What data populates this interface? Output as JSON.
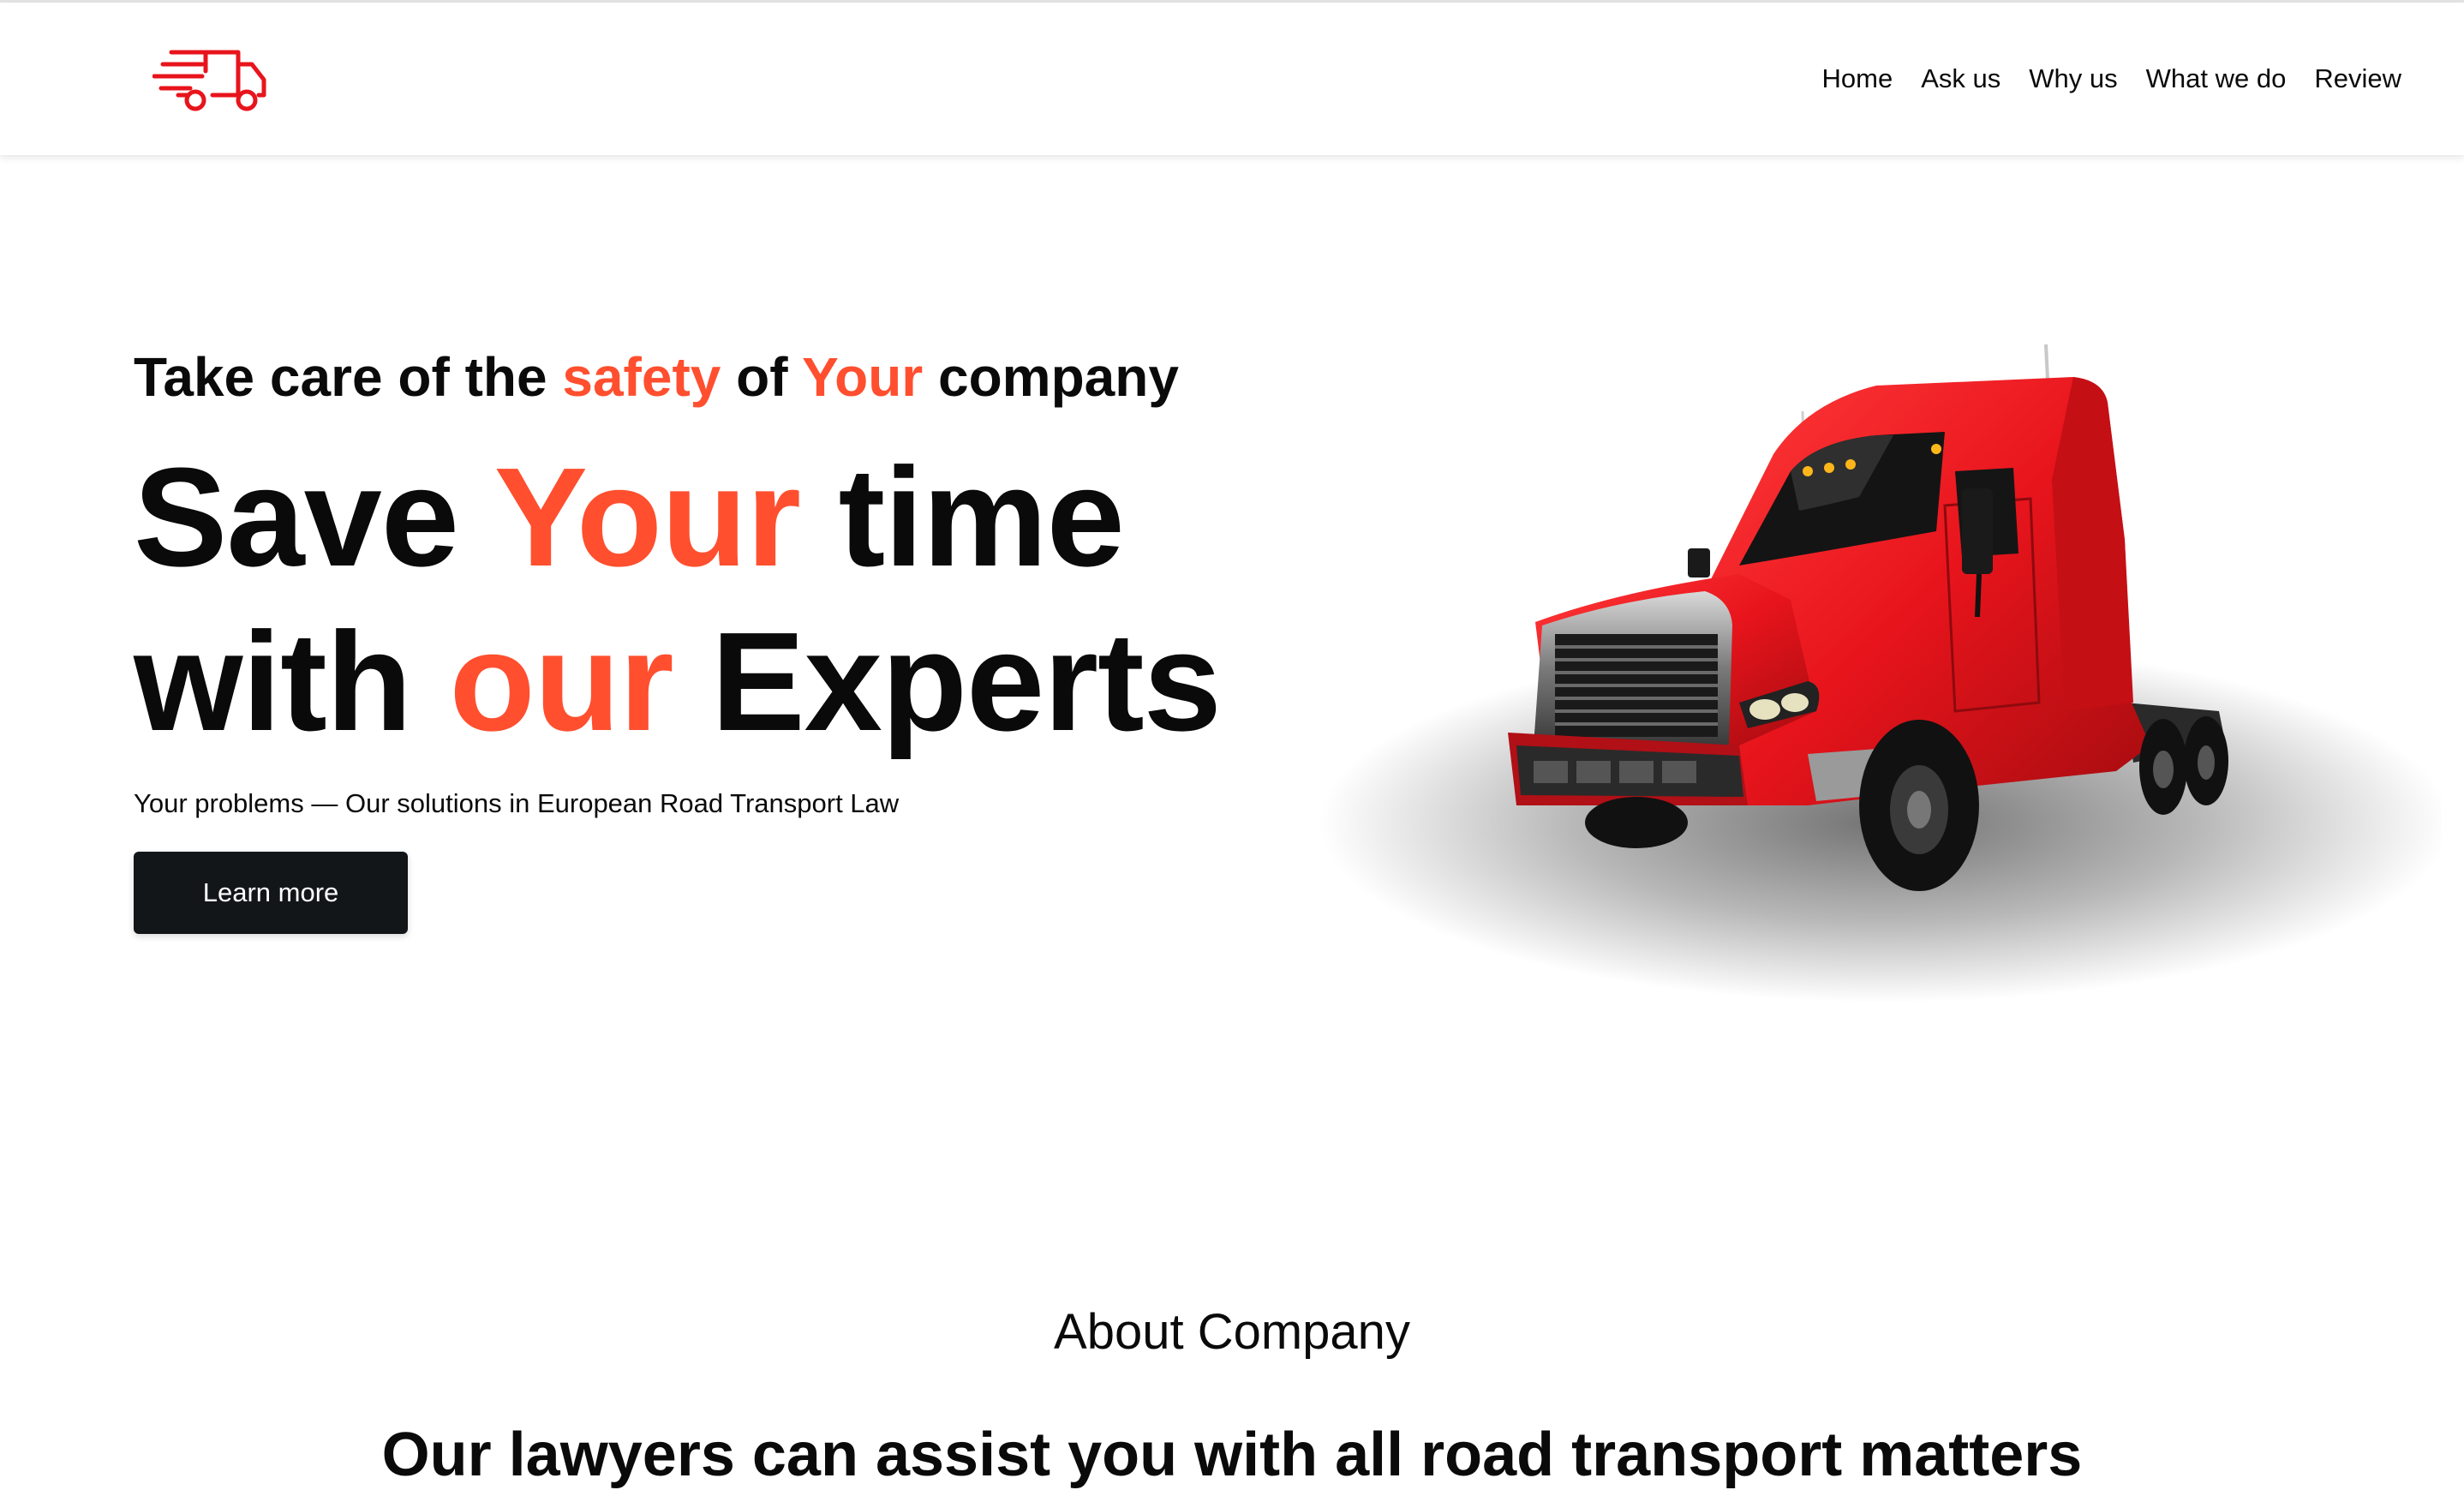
{
  "colors": {
    "accent": "#ff4f2f",
    "text": "#0a0a0a",
    "button_bg": "#131619",
    "truck_red": "#e8141c"
  },
  "header": {
    "logo_icon": "fast-delivery-truck-icon",
    "nav": [
      "Home",
      "Ask us",
      "Why us",
      "What we do",
      "Review"
    ]
  },
  "hero": {
    "tagline": {
      "part1": "Take care of the ",
      "accent1": "safety",
      "part2": " of ",
      "accent2": "Your",
      "part3": " company"
    },
    "headline": {
      "part1": "Save ",
      "accent1": "Your",
      "part2": " time",
      "part3": "with ",
      "accent2": "our",
      "part4": " Experts"
    },
    "subtitle": "Your problems — Our solutions in European Road Transport Law",
    "button": "Learn more",
    "image_icon": "red-semi-truck-image"
  },
  "about": {
    "title": "About Company",
    "heading": "Our lawyers can assist you with all road transport matters"
  }
}
